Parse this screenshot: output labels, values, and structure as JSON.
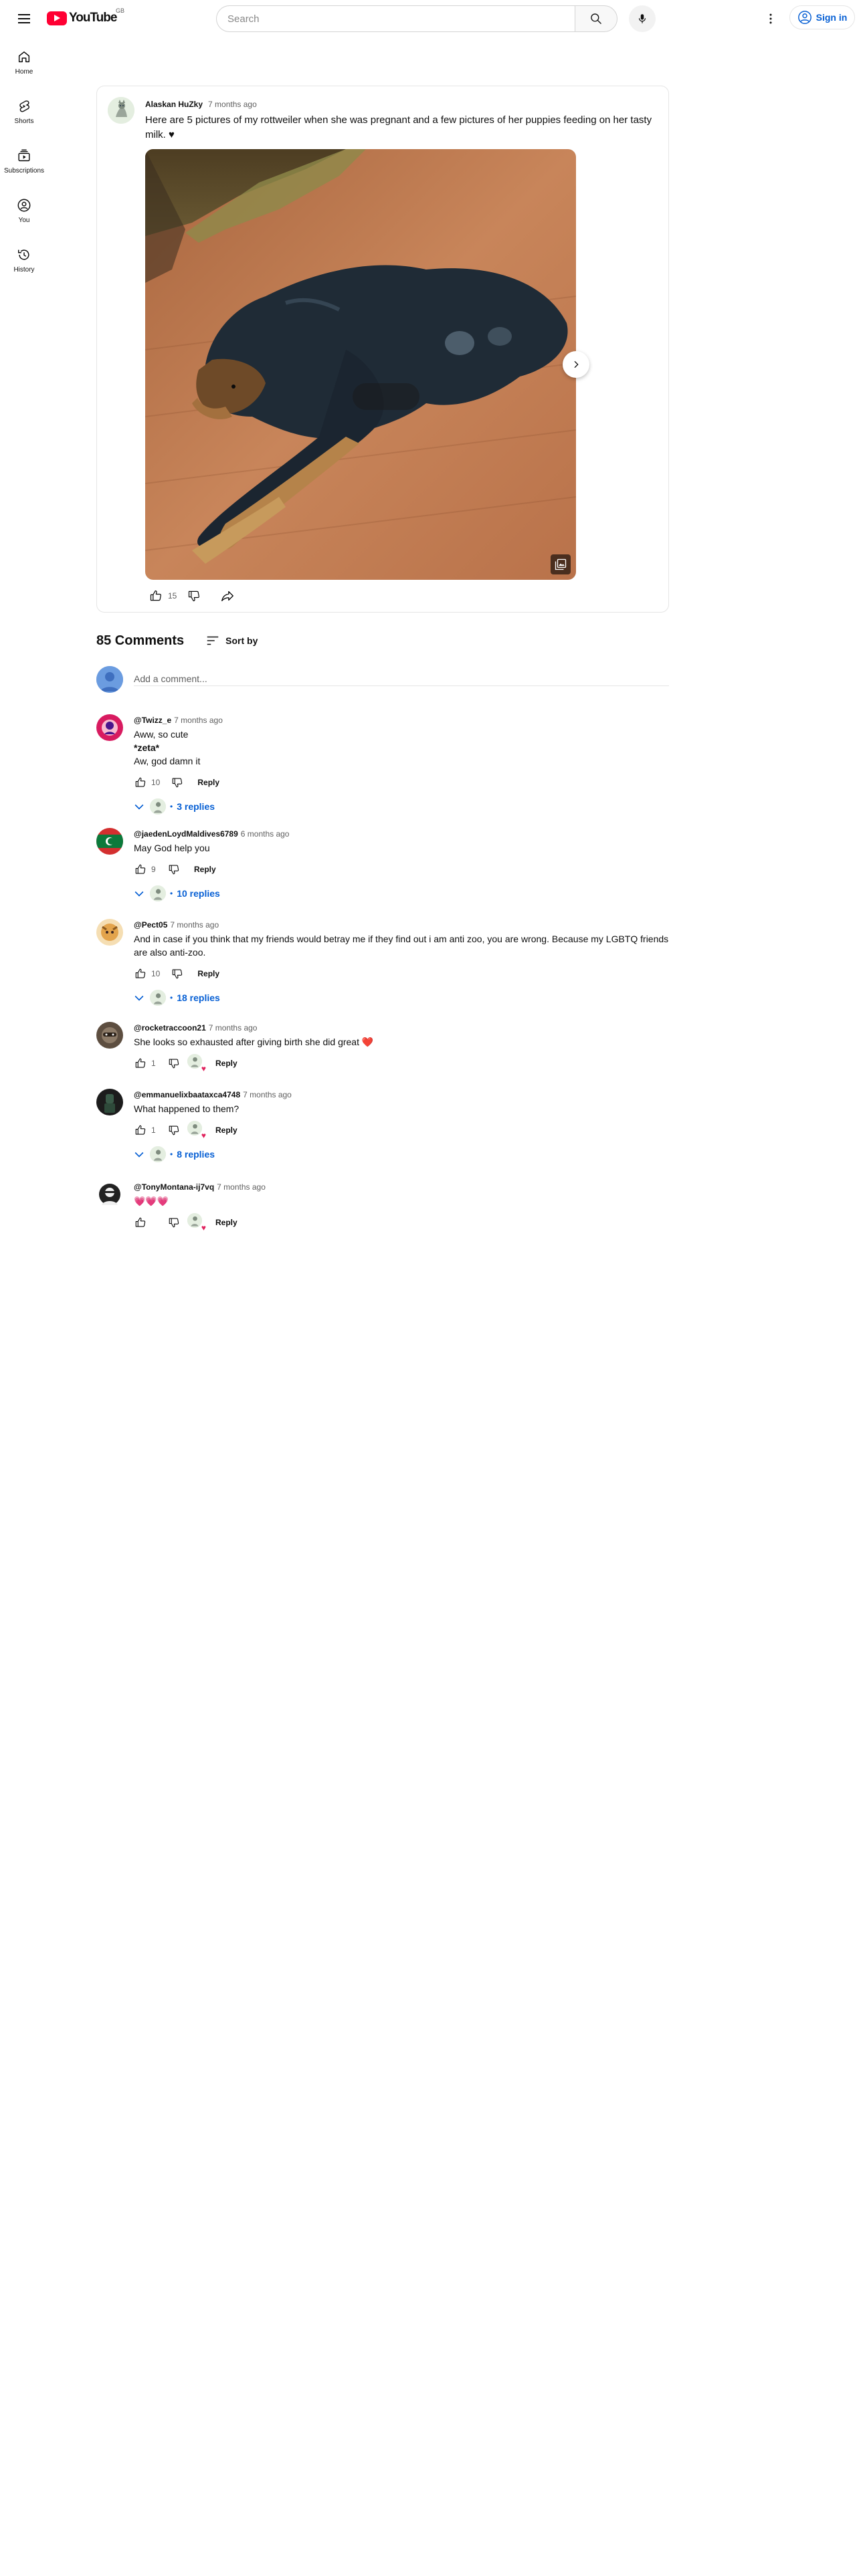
{
  "masthead": {
    "logo_text": "YouTube",
    "logo_country": "GB",
    "search_placeholder": "Search",
    "signin_label": "Sign in"
  },
  "guide": {
    "items": [
      {
        "label": "Home",
        "icon": "home-icon"
      },
      {
        "label": "Shorts",
        "icon": "shorts-icon"
      },
      {
        "label": "Subscriptions",
        "icon": "subscriptions-icon"
      },
      {
        "label": "You",
        "icon": "you-icon"
      },
      {
        "label": "History",
        "icon": "history-icon"
      }
    ]
  },
  "post": {
    "author": "Alaskan HuZky",
    "time": "7 months ago",
    "text": "Here are 5 pictures of my rottweiler when she was pregnant and a few pictures of her puppies feeding on her tasty milk. ♥",
    "likes": "15"
  },
  "comments_section": {
    "count_label": "85 Comments",
    "sort_label": "Sort by",
    "add_placeholder": "Add a comment..."
  },
  "comments": [
    {
      "author": "@Twizz_e",
      "time": "7 months ago",
      "lines": [
        "Aww, so cute",
        "*zeta*",
        "Aw, god damn it"
      ],
      "likes": "10",
      "reply_label": "Reply",
      "replies_label": "3 replies",
      "avatar_color": "#c2185b"
    },
    {
      "author": "@jaedenLoydMaldives6789",
      "time": "6 months ago",
      "lines": [
        "May God help you"
      ],
      "likes": "9",
      "reply_label": "Reply",
      "replies_label": "10 replies",
      "avatar_color": "#0b7a3b"
    },
    {
      "author": "@Pect05",
      "time": "7 months ago",
      "lines": [
        "And in case if you think that my friends would betray me if they find out i am anti zoo, you are wrong. Because my LGBTQ friends are also anti-zoo."
      ],
      "likes": "10",
      "reply_label": "Reply",
      "replies_label": "18 replies",
      "avatar_color": "#e3a44c"
    },
    {
      "author": "@rocketraccoon21",
      "time": "7 months ago",
      "lines": [
        "She looks so exhausted after giving birth she did great ❤️"
      ],
      "likes": "1",
      "reply_label": "Reply",
      "replies_label": "",
      "avatar_color": "#6b5b4b"
    },
    {
      "author": "@emmanuelixbaataxca4748",
      "time": "7 months ago",
      "lines": [
        "What happened to them?"
      ],
      "likes": "1",
      "reply_label": "Reply",
      "replies_label": "8 replies",
      "avatar_color": "#1e3b2e"
    },
    {
      "author": "@TonyMontana-ij7vq",
      "time": "7 months ago",
      "lines": [
        "💗💗💗"
      ],
      "likes": "",
      "reply_label": "Reply",
      "replies_label": "",
      "avatar_color": "#222222"
    }
  ]
}
